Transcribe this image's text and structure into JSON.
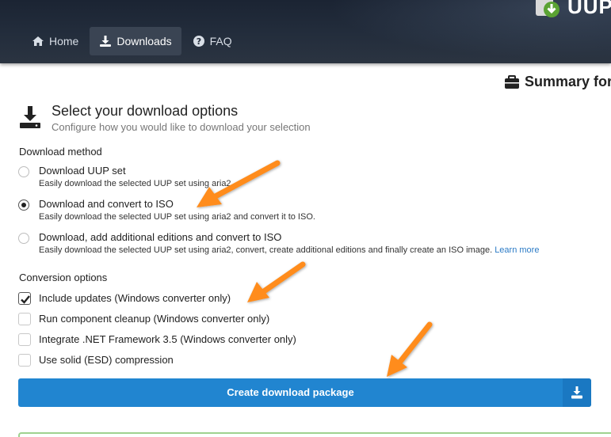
{
  "header": {
    "brand_title": "UUP",
    "nav": [
      {
        "label": "Home",
        "icon": "home-icon"
      },
      {
        "label": "Downloads",
        "icon": "download-icon",
        "active": true
      },
      {
        "label": "FAQ",
        "icon": "question-circle-icon"
      }
    ]
  },
  "summary": {
    "title": "Summary for y"
  },
  "section": {
    "title": "Select your download options",
    "subtitle": "Configure how you would like to download your selection"
  },
  "download_method": {
    "label": "Download method",
    "options": [
      {
        "label": "Download UUP set",
        "desc": "Easily download the selected UUP set using aria2.",
        "checked": false
      },
      {
        "label": "Download and convert to ISO",
        "desc": "Easily download the selected UUP set using aria2 and convert it to ISO.",
        "checked": true
      },
      {
        "label": "Download, add additional editions and convert to ISO",
        "desc": "Easily download the selected UUP set using aria2, convert, create additional editions and finally create an ISO image.",
        "link": "Learn more",
        "checked": false
      }
    ]
  },
  "conversion_options": {
    "label": "Conversion options",
    "options": [
      {
        "label": "Include updates (Windows converter only)",
        "checked": true
      },
      {
        "label": "Run component cleanup (Windows converter only)",
        "checked": false
      },
      {
        "label": "Integrate .NET Framework 3.5 (Windows converter only)",
        "checked": false
      },
      {
        "label": "Use solid (ESD) compression",
        "checked": false
      }
    ]
  },
  "actions": {
    "create_label": "Create download package"
  },
  "colors": {
    "primary": "#2185d0",
    "header_bg": "#232d3c",
    "arrow": "#ff8c1a",
    "link": "#2b7bc6"
  }
}
